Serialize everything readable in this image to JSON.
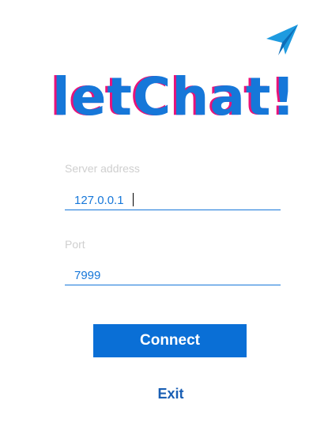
{
  "app": {
    "logo_text": "letChat!",
    "logo_icon": "paper-plane-icon"
  },
  "colors": {
    "accent": "#1677d9",
    "logo_shadow": "#e8137a",
    "button_bg": "#0a6fd6",
    "label_text": "#cfcfcf"
  },
  "form": {
    "server_label": "Server address",
    "server_value": "127.0.0.1",
    "port_label": "Port",
    "port_value": "7999"
  },
  "actions": {
    "connect_label": "Connect",
    "exit_label": "Exit"
  }
}
